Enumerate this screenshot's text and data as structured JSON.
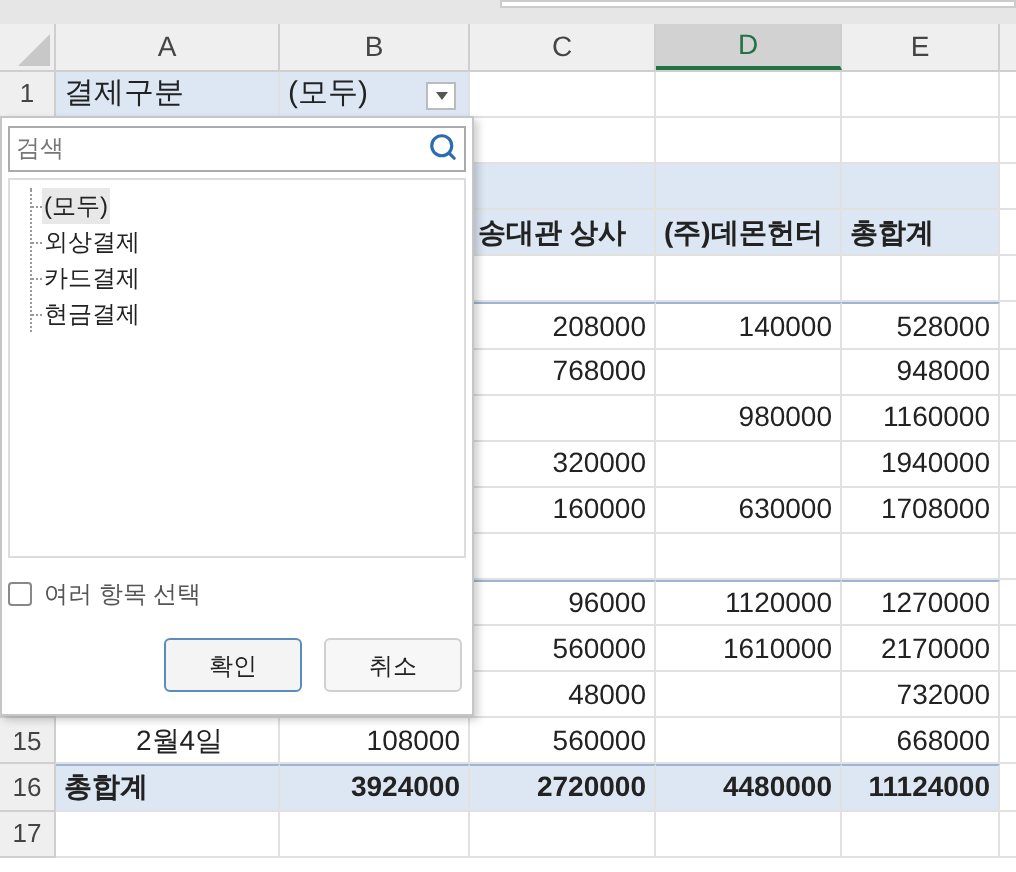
{
  "columns": [
    {
      "label": "A",
      "selected": false
    },
    {
      "label": "B",
      "selected": false
    },
    {
      "label": "C",
      "selected": false
    },
    {
      "label": "D",
      "selected": true
    },
    {
      "label": "E",
      "selected": false
    }
  ],
  "rows": [
    {
      "kind": "field",
      "number": "1",
      "cells": {
        "A": "결제구분",
        "B": "(모두)"
      }
    },
    {
      "kind": "data"
    },
    {
      "kind": "header"
    },
    {
      "kind": "header",
      "cells": {
        "C": "송대관 상사",
        "D": "(주)데몬헌터",
        "E": "총합계"
      }
    },
    {
      "kind": "data"
    },
    {
      "kind": "data",
      "cells": {
        "C": "208000",
        "D": "140000",
        "E": "528000"
      }
    },
    {
      "kind": "data",
      "cells": {
        "C": "768000",
        "E": "948000"
      }
    },
    {
      "kind": "data",
      "cells": {
        "D": "980000",
        "E": "1160000"
      }
    },
    {
      "kind": "data",
      "cells": {
        "C": "320000",
        "E": "1940000"
      }
    },
    {
      "kind": "data",
      "cells": {
        "C": "160000",
        "D": "630000",
        "E": "1708000"
      }
    },
    {
      "kind": "data"
    },
    {
      "kind": "data",
      "cells": {
        "C": "96000",
        "D": "1120000",
        "E": "1270000"
      }
    },
    {
      "kind": "data",
      "cells": {
        "C": "560000",
        "D": "1610000",
        "E": "2170000"
      }
    },
    {
      "kind": "data",
      "cells": {
        "C": "48000",
        "E": "732000"
      }
    },
    {
      "kind": "data",
      "number": "15",
      "cells": {
        "A": "2월4일",
        "B": "108000",
        "C": "560000",
        "E": "668000"
      }
    },
    {
      "kind": "total",
      "number": "16",
      "cells": {
        "A": "총합계",
        "B": "3924000",
        "C": "2720000",
        "D": "4480000",
        "E": "11124000"
      }
    },
    {
      "kind": "data",
      "number": "17"
    }
  ],
  "filter_popup": {
    "search": {
      "placeholder": "검색"
    },
    "items": [
      {
        "label": "(모두)",
        "selected": true
      },
      {
        "label": "외상결제",
        "selected": false
      },
      {
        "label": "카드결제",
        "selected": false
      },
      {
        "label": "현금결제",
        "selected": false
      }
    ],
    "multi_select": {
      "label": "여러 항목 선택",
      "checked": false
    },
    "buttons": [
      {
        "label": "확인",
        "kind": "primary"
      },
      {
        "label": "취소",
        "kind": "secondary"
      }
    ]
  }
}
